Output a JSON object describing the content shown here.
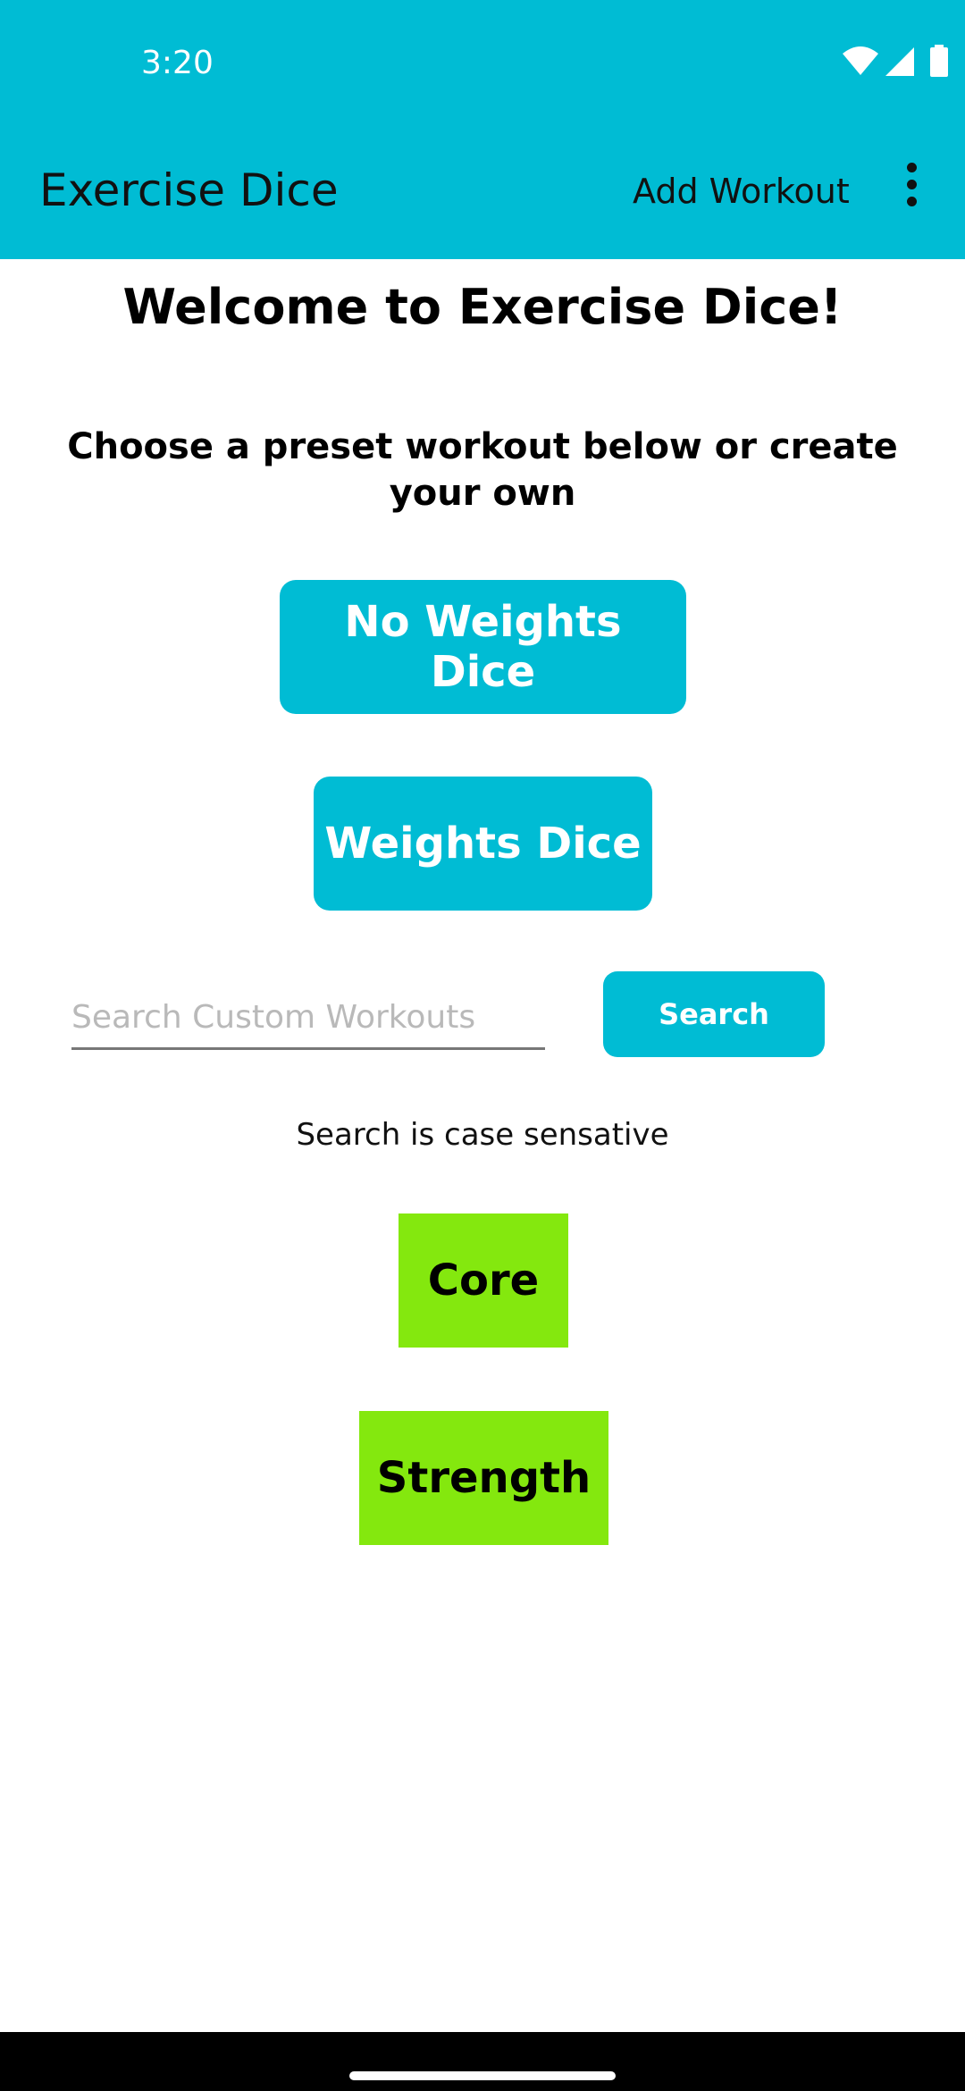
{
  "status_bar": {
    "time": "3:20"
  },
  "app_bar": {
    "title": "Exercise Dice",
    "add_workout_label": "Add Workout"
  },
  "main": {
    "welcome": "Welcome to Exercise Dice!",
    "subtitle": "Choose a preset workout below or create your own",
    "preset_buttons": [
      "No Weights Dice",
      "Weights Dice"
    ],
    "search": {
      "placeholder": "Search Custom Workouts",
      "value": "",
      "button_label": "Search",
      "note": "Search is case sensative"
    },
    "custom_workouts": [
      "Core",
      "Strength"
    ]
  },
  "colors": {
    "accent": "#00bcd4",
    "tile": "#84e80e",
    "nav_bar": "#000000"
  },
  "icons": [
    "wifi-icon",
    "cellular-signal-icon",
    "battery-icon",
    "more-vert-icon"
  ]
}
